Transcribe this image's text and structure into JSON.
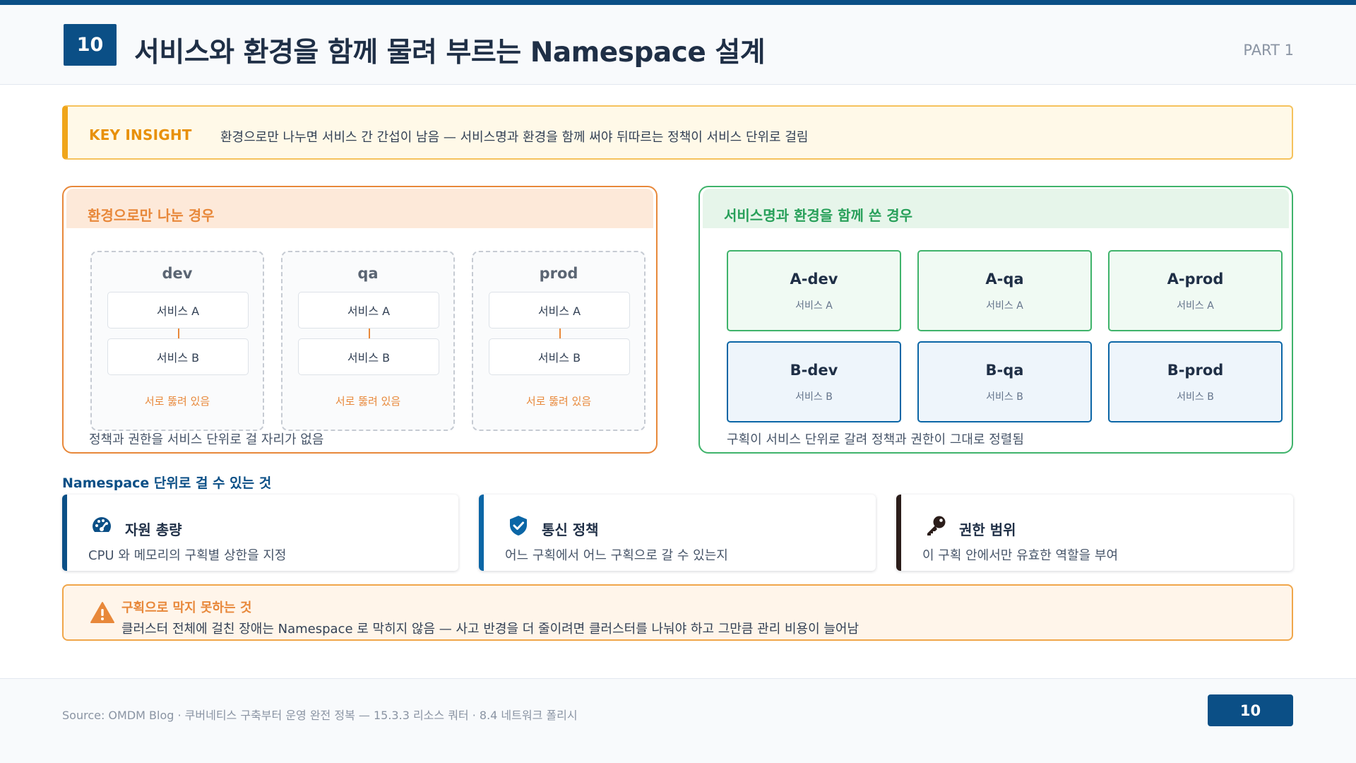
{
  "header": {
    "number": "10",
    "title": "서비스와 환경을 함께 물려 부르는 Namespace 설계",
    "part": "PART 1"
  },
  "insight": {
    "key": "KEY INSIGHT",
    "text": "환경으로만 나누면 서비스 간 간섭이 남음 — 서비스명과 환경을 함께 써야 뒤따르는 정책이 서비스 단위로 걸림"
  },
  "left_panel": {
    "title": "환경으로만 나눈 경우",
    "caption": "정책과 권한을 서비스 단위로 걸 자리가 없음",
    "envs": [
      {
        "name": "dev",
        "service_a": "서비스 A",
        "service_b": "서비스 B",
        "note": "서로 뚫려 있음"
      },
      {
        "name": "qa",
        "service_a": "서비스 A",
        "service_b": "서비스 B",
        "note": "서로 뚫려 있음"
      },
      {
        "name": "prod",
        "service_a": "서비스 A",
        "service_b": "서비스 B",
        "note": "서로 뚫려 있음"
      }
    ]
  },
  "right_panel": {
    "title": "서비스명과 환경을 함께 쓴 경우",
    "caption": "구획이 서비스 단위로 갈려 정책과 권한이 그대로 정렬됨",
    "namespaces": [
      {
        "name": "A-dev",
        "service": "서비스 A"
      },
      {
        "name": "A-qa",
        "service": "서비스 A"
      },
      {
        "name": "A-prod",
        "service": "서비스 A"
      },
      {
        "name": "B-dev",
        "service": "서비스 B"
      },
      {
        "name": "B-qa",
        "service": "서비스 B"
      },
      {
        "name": "B-prod",
        "service": "서비스 B"
      }
    ]
  },
  "features": {
    "label": "Namespace 단위로 걸 수 있는 것",
    "items": [
      {
        "icon": "gauge-icon",
        "title": "자원 총량",
        "desc": "CPU 와 메모리의 구획별 상한을 지정",
        "color": "#0b4f86"
      },
      {
        "icon": "shield-check-icon",
        "title": "통신 정책",
        "desc": "어느 구획에서 어느 구획으로 갈 수 있는지",
        "color": "#0b66a6"
      },
      {
        "icon": "key-icon",
        "title": "권한 범위",
        "desc": "이 구획 안에서만 유효한 역할을 부여",
        "color": "#2b1d1a"
      }
    ]
  },
  "warning": {
    "title": "구획으로 막지 못하는 것",
    "text": "클러스터 전체에 걸친 장애는 Namespace 로 막히지 않음 — 사고 반경을 더 줄이려면 클러스터를 나눠야 하고 그만큼 관리 비용이 늘어남"
  },
  "footer": {
    "source": "Source: OMDM Blog · 쿠버네티스 구축부터 운영 완전 정복 — 15.3.3 리소스 쿼터 · 8.4 네트워크 폴리시",
    "page": "10"
  },
  "colors": {
    "primary": "#0b4f86",
    "orange": "#e8883a",
    "green": "#3fb36b",
    "amber": "#f0a51a"
  }
}
